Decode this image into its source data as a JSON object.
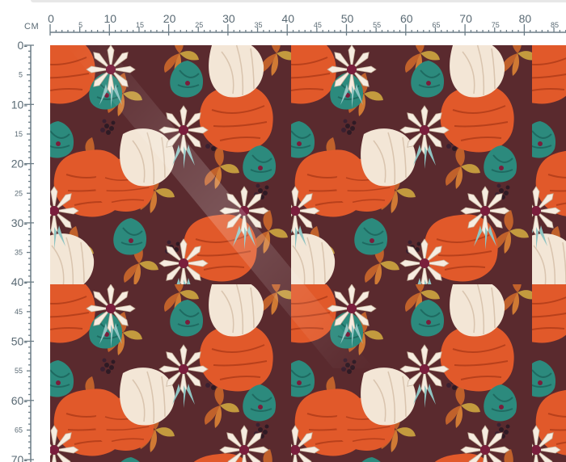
{
  "ruler": {
    "unit_label": "CM",
    "top_major": [
      "0",
      "10",
      "20",
      "30",
      "40",
      "50",
      "60",
      "70",
      "80"
    ],
    "top_minor": [
      "5",
      "15",
      "25",
      "35",
      "45",
      "55",
      "65",
      "75",
      "85"
    ],
    "left_major": [
      "0-",
      "10-",
      "20-",
      "30-",
      "40-",
      "50-",
      "60-",
      "70-"
    ],
    "left_minor": [
      "5",
      "15",
      "25",
      "35",
      "45",
      "55",
      "65"
    ]
  },
  "colors": {
    "ruler_line": "#6b7c86",
    "ruler_text": "#5a6a74",
    "fabric_bg": "#5a2a2e",
    "poppy_orange": "#e1592a",
    "teal": "#2c8a7d",
    "cream": "#f3e6d6",
    "rust_leaf": "#c0612b",
    "gold_leaf": "#c39a3e",
    "dark_berry": "#2e1a24"
  },
  "pattern": {
    "name": "autumn floral print"
  }
}
